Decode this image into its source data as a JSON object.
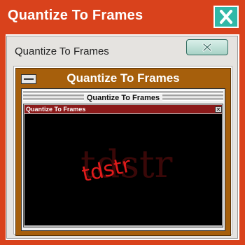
{
  "windows": {
    "outer_title": "Quantize To Frames",
    "second_title": "Quantize To Frames",
    "third_title": "Quantize To Frames",
    "fourth_title": "Quantize To Frames",
    "inner_title": "Quantize To Frames"
  },
  "icons": {
    "outer_close": "close-icon",
    "second_close": "close-icon",
    "third_menu": "system-menu-icon",
    "inner_close": "close-icon"
  },
  "content": {
    "watermark": "tdstr",
    "watermark_shadow": "tdstr"
  },
  "colors": {
    "outer_frame": "#d9421c",
    "outer_close_bg": "#31b8a8",
    "third_frame": "#a65f0c",
    "inner_titlebar": "#8b1a1a",
    "watermark": "#e11b1b",
    "content_bg": "#000000"
  }
}
